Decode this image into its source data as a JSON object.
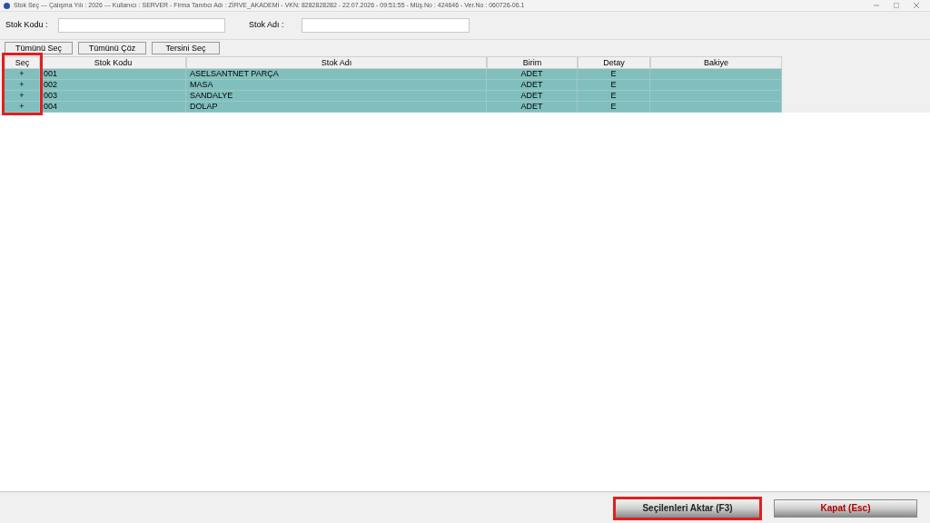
{
  "window": {
    "title": "Stok Seç  ---  Çalışma Yılı : 2026  ---  Kullanıcı : SERVER - Firma Tanıtıcı Adı : ZİRVE_AKADEMİ - VKN: 8282828282 - 22.07.2026 - 09:51:55 - Müş.No : 424646 - Ver.No : 060726-06.1"
  },
  "filters": [
    {
      "label": "Stok Kodu :"
    },
    {
      "label": "Stok Adı :"
    }
  ],
  "toolbar": [
    "Tümünü Seç",
    "Tümünü Çöz",
    "Tersini Seç"
  ],
  "table": {
    "columns": [
      {
        "label": "Seç",
        "highlighted": true
      },
      {
        "label": "Stok Kodu",
        "highlighted": false
      },
      {
        "label": "Stok Adı",
        "highlighted": false
      },
      {
        "label": "Birim",
        "highlighted": false
      },
      {
        "label": "Detay",
        "highlighted": false
      },
      {
        "label": "Bakiye",
        "highlighted": false
      }
    ],
    "rows": [
      {
        "selected": true,
        "cells": [
          "+",
          "001",
          "ASELSANTNET PARÇA",
          "ADET",
          "E",
          ""
        ]
      },
      {
        "selected": true,
        "cells": [
          "+",
          "002",
          "MASA",
          "ADET",
          "E",
          ""
        ]
      },
      {
        "selected": true,
        "cells": [
          "+",
          "003",
          "SANDALYE",
          "ADET",
          "E",
          ""
        ]
      },
      {
        "selected": true,
        "cells": [
          "+",
          "004",
          "DOLAP",
          "ADET",
          "E",
          ""
        ]
      }
    ]
  },
  "footer": {
    "buttons": [
      {
        "label": "Seçilenleri Aktar (F3)",
        "kind": "primary",
        "highlighted": true
      },
      {
        "label": "Kapat (Esc)",
        "kind": "close",
        "highlighted": false
      }
    ]
  }
}
